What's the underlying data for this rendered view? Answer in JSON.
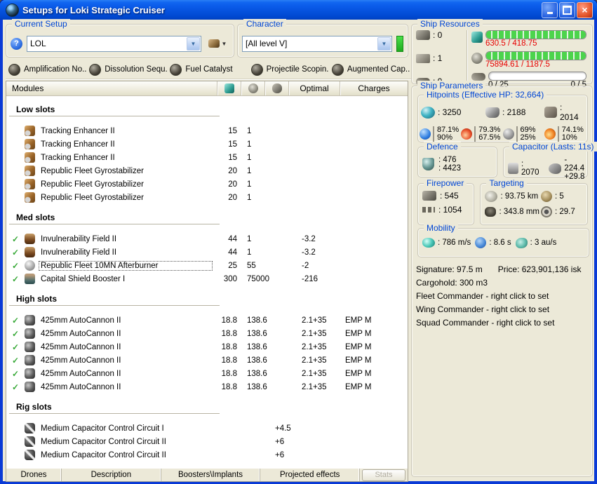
{
  "window": {
    "title": "Setups for Loki Strategic Cruiser"
  },
  "toolbar": {
    "current_setup_label": "Current Setup",
    "setup_value": "LOL",
    "character_label": "Character",
    "character_value": "[All level V]"
  },
  "subsystems": [
    {
      "label": "Amplification No..."
    },
    {
      "label": "Dissolution Sequ..."
    },
    {
      "label": "Fuel Catalyst"
    },
    {
      "label": "Projectile Scopin..."
    },
    {
      "label": "Augmented Cap..."
    }
  ],
  "modules": {
    "header": {
      "title": "Modules",
      "optimal": "Optimal",
      "charges": "Charges"
    },
    "sections": [
      {
        "name": "Low slots",
        "rows": [
          {
            "icon": "m-tan",
            "icon_name": "tracking-enhancer-icon",
            "check": false,
            "name": "Tracking Enhancer II",
            "cpu": "15",
            "pg": "1",
            "cap": "",
            "charge": ""
          },
          {
            "icon": "m-tan",
            "icon_name": "tracking-enhancer-icon",
            "check": false,
            "name": "Tracking Enhancer II",
            "cpu": "15",
            "pg": "1",
            "cap": "",
            "charge": ""
          },
          {
            "icon": "m-tan",
            "icon_name": "tracking-enhancer-icon",
            "check": false,
            "name": "Tracking Enhancer II",
            "cpu": "15",
            "pg": "1",
            "cap": "",
            "charge": ""
          },
          {
            "icon": "m-tan",
            "icon_name": "gyrostabilizer-icon",
            "check": false,
            "name": "Republic Fleet Gyrostabilizer",
            "cpu": "20",
            "pg": "1",
            "cap": "",
            "charge": ""
          },
          {
            "icon": "m-tan",
            "icon_name": "gyrostabilizer-icon",
            "check": false,
            "name": "Republic Fleet Gyrostabilizer",
            "cpu": "20",
            "pg": "1",
            "cap": "",
            "charge": ""
          },
          {
            "icon": "m-tan",
            "icon_name": "gyrostabilizer-icon",
            "check": false,
            "name": "Republic Fleet Gyrostabilizer",
            "cpu": "20",
            "pg": "1",
            "cap": "",
            "charge": ""
          }
        ]
      },
      {
        "name": "Med slots",
        "rows": [
          {
            "icon": "m-copper",
            "icon_name": "invulnerability-field-icon",
            "check": true,
            "name": "Invulnerability Field II",
            "cpu": "44",
            "pg": "1",
            "cap": "-3.2",
            "charge": ""
          },
          {
            "icon": "m-copper",
            "icon_name": "invulnerability-field-icon",
            "check": true,
            "name": "Invulnerability Field II",
            "cpu": "44",
            "pg": "1",
            "cap": "-3.2",
            "charge": ""
          },
          {
            "icon": "m-sphere",
            "icon_name": "afterburner-icon",
            "check": true,
            "selected": true,
            "name": "Republic Fleet 10MN Afterburner",
            "cpu": "25",
            "pg": "55",
            "cap": "-2",
            "charge": ""
          },
          {
            "icon": "m-sboost",
            "icon_name": "shield-booster-icon",
            "check": true,
            "name": "Capital Shield Booster I",
            "cpu": "300",
            "pg": "75000",
            "cap": "-216",
            "charge": ""
          }
        ]
      },
      {
        "name": "High slots",
        "rows": [
          {
            "icon": "m-gun",
            "icon_name": "autocannon-icon",
            "check": true,
            "name": "425mm AutoCannon II",
            "cpu": "18.8",
            "pg": "138.6",
            "cap": "2.1+35",
            "charge": "EMP M"
          },
          {
            "icon": "m-gun",
            "icon_name": "autocannon-icon",
            "check": true,
            "name": "425mm AutoCannon II",
            "cpu": "18.8",
            "pg": "138.6",
            "cap": "2.1+35",
            "charge": "EMP M"
          },
          {
            "icon": "m-gun",
            "icon_name": "autocannon-icon",
            "check": true,
            "name": "425mm AutoCannon II",
            "cpu": "18.8",
            "pg": "138.6",
            "cap": "2.1+35",
            "charge": "EMP M"
          },
          {
            "icon": "m-gun",
            "icon_name": "autocannon-icon",
            "check": true,
            "name": "425mm AutoCannon II",
            "cpu": "18.8",
            "pg": "138.6",
            "cap": "2.1+35",
            "charge": "EMP M"
          },
          {
            "icon": "m-gun",
            "icon_name": "autocannon-icon",
            "check": true,
            "name": "425mm AutoCannon II",
            "cpu": "18.8",
            "pg": "138.6",
            "cap": "2.1+35",
            "charge": "EMP M"
          },
          {
            "icon": "m-gun",
            "icon_name": "autocannon-icon",
            "check": true,
            "name": "425mm AutoCannon II",
            "cpu": "18.8",
            "pg": "138.6",
            "cap": "2.1+35",
            "charge": "EMP M"
          }
        ]
      },
      {
        "name": "Rig slots",
        "rows": [
          {
            "icon": "m-rig",
            "icon_name": "rig-icon",
            "check": false,
            "name": "Medium Capacitor Control Circuit I",
            "rig": "+4.5"
          },
          {
            "icon": "m-rig",
            "icon_name": "rig-icon",
            "check": false,
            "name": "Medium Capacitor Control Circuit II",
            "rig": "+6"
          },
          {
            "icon": "m-rig",
            "icon_name": "rig-icon",
            "check": false,
            "name": "Medium Capacitor Control Circuit II",
            "rig": "+6"
          }
        ]
      }
    ]
  },
  "bottom_tabs": [
    {
      "label": "Drones"
    },
    {
      "label": "Description"
    },
    {
      "label": "Boosters\\Implants"
    },
    {
      "label": "Projected effects"
    }
  ],
  "stats_button": "Stats",
  "ship_resources": {
    "label": "Ship Resources",
    "slots": [
      {
        "icon": "i-turret",
        "icon_name": "turret-hardpoints-icon",
        "value": ": 0"
      },
      {
        "icon": "i-launcher",
        "icon_name": "launcher-hardpoints-icon",
        "value": ": 1"
      },
      {
        "icon": "i-rigslot",
        "icon_name": "rig-slots-icon",
        "value": ": 0"
      }
    ],
    "cpu": {
      "text": "630.5 / 418.75",
      "fill": 1
    },
    "powergrid": {
      "text": "75894.61 / 1187.5",
      "fill": 1
    },
    "calibration": {
      "left": "0 / 25",
      "right": "0 / 5",
      "fill": 0
    }
  },
  "ship_parameters": {
    "label": "Ship Parameters",
    "hitpoints": {
      "label": "Hitpoints (Effective HP: 32,664)",
      "shield": ": 3250",
      "armor": ": 2188",
      "structure": ": 2014",
      "resists": [
        {
          "name": "em",
          "top": "87.1%",
          "bottom": "90%"
        },
        {
          "name": "thermal",
          "top": "79.3%",
          "bottom": "67.5%"
        },
        {
          "name": "kinetic",
          "top": "69%",
          "bottom": "25%"
        },
        {
          "name": "explosive",
          "top": "74.1%",
          "bottom": "10%"
        }
      ]
    },
    "defence": {
      "label": "Defence",
      "line1": ": 476",
      "line2": ": 4423"
    },
    "capacitor": {
      "label": "Capacitor (Lasts: 11s)",
      "amount": ": 2070",
      "delta_top": "- 224.4",
      "delta_bottom": "+29.8"
    },
    "firepower": {
      "label": "Firepower",
      "turret": ": 545",
      "volley": ": 1054"
    },
    "targeting": {
      "label": "Targeting",
      "range": ": 93.75 km",
      "max_targets": ": 5",
      "scan_res": ": 343.8 mm",
      "sensor_strength": ": 29.7"
    },
    "mobility": {
      "label": "Mobility",
      "speed": ": 786 m/s",
      "align": ": 8.6 s",
      "warp": ": 3 au/s"
    },
    "info": {
      "signature": "Signature: 97.5 m",
      "price": "Price: 623,901,136 isk",
      "cargohold": "Cargohold: 300 m3",
      "fleet": "Fleet Commander - right click to set",
      "wing": "Wing Commander - right click to set",
      "squad": "Squad Commander - right click to set"
    }
  }
}
